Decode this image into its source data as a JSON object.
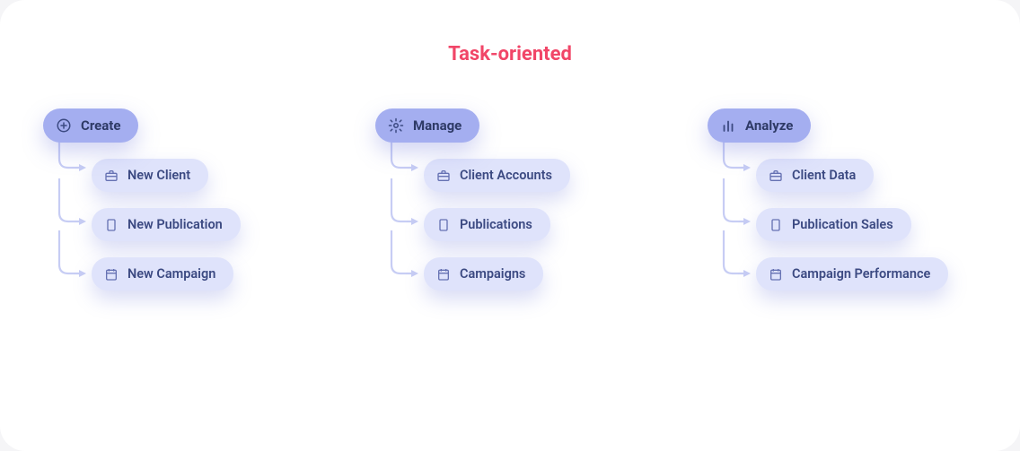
{
  "title": "Task-oriented",
  "columns": [
    {
      "head": {
        "label": "Create",
        "icon": "plus-circle"
      },
      "children": [
        {
          "label": "New Client",
          "icon": "briefcase"
        },
        {
          "label": "New Publication",
          "icon": "document"
        },
        {
          "label": "New Campaign",
          "icon": "calendar"
        }
      ]
    },
    {
      "head": {
        "label": "Manage",
        "icon": "gear"
      },
      "children": [
        {
          "label": "Client Accounts",
          "icon": "briefcase"
        },
        {
          "label": "Publications",
          "icon": "document"
        },
        {
          "label": "Campaigns",
          "icon": "calendar"
        }
      ]
    },
    {
      "head": {
        "label": "Analyze",
        "icon": "bar-chart"
      },
      "children": [
        {
          "label": "Client Data",
          "icon": "briefcase"
        },
        {
          "label": "Publication Sales",
          "icon": "document"
        },
        {
          "label": "Campaign Performance",
          "icon": "calendar"
        }
      ]
    }
  ],
  "colors": {
    "title": "#f14668",
    "headPill": "#a4aef0",
    "childPill": "#dfe3fb",
    "connector": "#c7cdf4",
    "text": "#3c4a82"
  }
}
